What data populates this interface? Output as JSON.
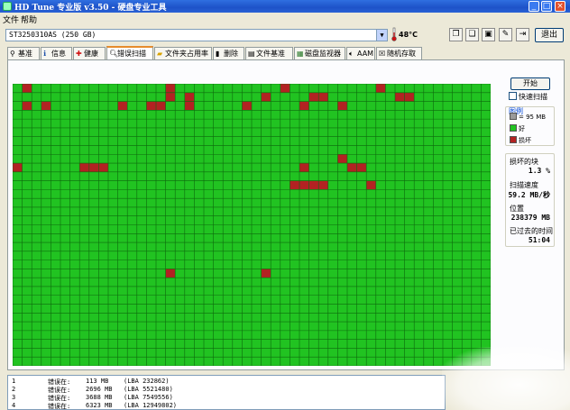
{
  "window": {
    "title": "HD Tune 专业版 v3.50 - 硬盘专业工具",
    "controls": {
      "minimize": "_",
      "maximize": "□",
      "close": "×"
    }
  },
  "menu": [
    "文件",
    "帮助"
  ],
  "toolbar": {
    "drive_selected": "ST3250310AS (250 GB)",
    "temperature": "48°C",
    "exit_label": "退出",
    "icon_buttons": [
      "copy-info-icon",
      "copy-screenshot-icon",
      "save-icon",
      "options-icon",
      "exit-icon"
    ]
  },
  "tabs": [
    {
      "label": "基准",
      "icon": "benchmark-icon"
    },
    {
      "label": "信息",
      "icon": "info-icon"
    },
    {
      "label": "健康",
      "icon": "health-icon"
    },
    {
      "label": "错误扫描",
      "icon": "error-scan-icon",
      "active": true
    },
    {
      "label": "文件夹占用率",
      "icon": "folder-usage-icon"
    },
    {
      "label": "删除",
      "icon": "erase-icon"
    },
    {
      "label": "文件基准",
      "icon": "file-benchmark-icon"
    },
    {
      "label": "磁盘监视器",
      "icon": "disk-monitor-icon"
    },
    {
      "label": "AAM",
      "icon": "aam-icon"
    },
    {
      "label": "随机存取",
      "icon": "random-access-icon"
    }
  ],
  "scan": {
    "start_label": "开始",
    "quick_scan_label": "快速扫描",
    "quick_scan_checked": false,
    "grid": {
      "cols": 50,
      "rows": 32,
      "good_color": "#21c321",
      "bad_color": "#b22222",
      "line_color": "#0d6a0d",
      "bad_blocks": [
        [
          1,
          0
        ],
        [
          16,
          0
        ],
        [
          28,
          0
        ],
        [
          38,
          0
        ],
        [
          16,
          1
        ],
        [
          18,
          1
        ],
        [
          26,
          1
        ],
        [
          31,
          1
        ],
        [
          32,
          1
        ],
        [
          40,
          1
        ],
        [
          41,
          1
        ],
        [
          1,
          2
        ],
        [
          3,
          2
        ],
        [
          11,
          2
        ],
        [
          14,
          2
        ],
        [
          15,
          2
        ],
        [
          18,
          2
        ],
        [
          24,
          2
        ],
        [
          30,
          2
        ],
        [
          34,
          2
        ],
        [
          0,
          9
        ],
        [
          7,
          9
        ],
        [
          8,
          9
        ],
        [
          9,
          9
        ],
        [
          30,
          9
        ],
        [
          35,
          9
        ],
        [
          36,
          9
        ],
        [
          34,
          8
        ],
        [
          29,
          11
        ],
        [
          30,
          11
        ],
        [
          31,
          11
        ],
        [
          32,
          11
        ],
        [
          37,
          11
        ],
        [
          16,
          21
        ],
        [
          26,
          21
        ]
      ]
    },
    "legend": {
      "title": "图例",
      "block_size": "= 95 MB",
      "good_label": "好",
      "bad_label": "损坏",
      "block_color": "#9a9a9a"
    },
    "stats": {
      "damaged_label": "损坏的块",
      "damaged_value": "1.3 %",
      "speed_label": "扫描速度",
      "speed_value": "59.2 MB/秒",
      "position_label": "位置",
      "position_value": "238379 MB",
      "elapsed_label": "已过去的时间",
      "elapsed_value": "51:04"
    },
    "log": [
      {
        "n": "1",
        "text": "错误在:",
        "mb": "113 MB",
        "lba": "(LBA 232862)"
      },
      {
        "n": "2",
        "text": "错误在:",
        "mb": "2696 MB",
        "lba": "(LBA 5521480)"
      },
      {
        "n": "3",
        "text": "错误在:",
        "mb": "3688 MB",
        "lba": "(LBA 7549556)"
      },
      {
        "n": "4",
        "text": "错误在:",
        "mb": "6323 MB",
        "lba": "(LBA 12949802)"
      }
    ]
  }
}
